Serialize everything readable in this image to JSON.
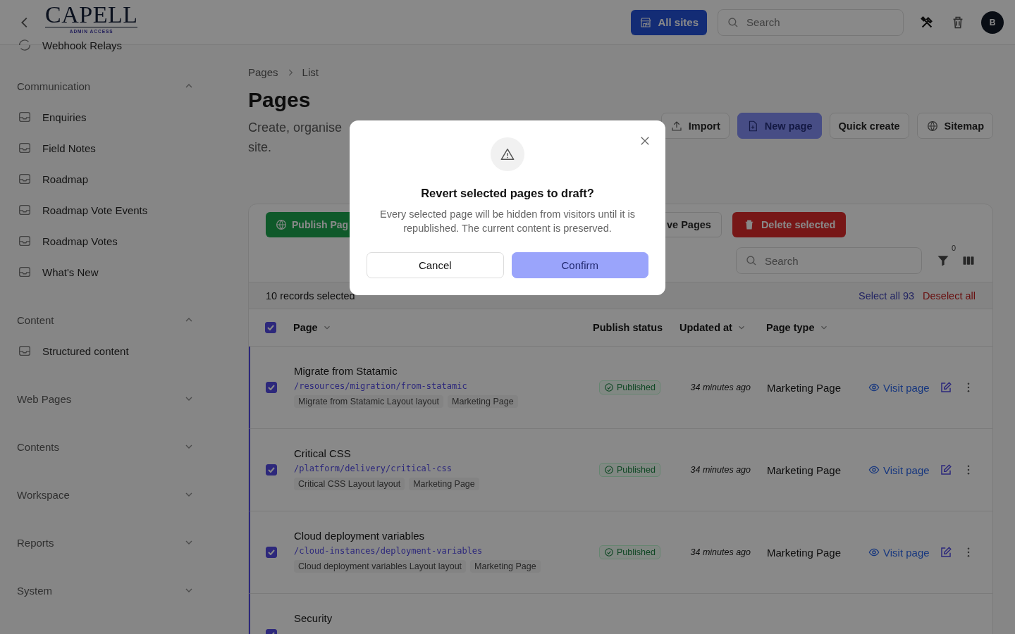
{
  "header": {
    "logo": {
      "name": "CAPELL",
      "tagline": "ADMIN ACCESS"
    },
    "sites_button": "All sites",
    "search": {
      "placeholder": "Search"
    },
    "avatar": "B"
  },
  "sidebar": {
    "partial_item": "Webhook Relays",
    "groups": [
      {
        "label": "Communication",
        "expanded": true,
        "items": [
          "Enquiries",
          "Field Notes",
          "Roadmap",
          "Roadmap Vote Events",
          "Roadmap Votes",
          "What's New"
        ]
      },
      {
        "label": "Content",
        "expanded": true,
        "items": [
          "Structured content"
        ]
      },
      {
        "label": "Web Pages",
        "expanded": false
      },
      {
        "label": "Contents",
        "expanded": false
      },
      {
        "label": "Workspace",
        "expanded": false
      },
      {
        "label": "Reports",
        "expanded": false
      },
      {
        "label": "System",
        "expanded": false
      }
    ]
  },
  "breadcrumb": [
    "Pages",
    "List"
  ],
  "title": "Pages",
  "subtitle_lines": [
    "Create, organise",
    "site."
  ],
  "page_actions": [
    {
      "label": "Import",
      "kind": "import"
    },
    {
      "label": "New page",
      "kind": "primary"
    },
    {
      "label": "Quick create",
      "kind": "plain"
    },
    {
      "label": "Sitemap",
      "kind": "sitemap"
    }
  ],
  "bulk_actions": [
    {
      "label": "Publish Pag",
      "kind": "publish"
    },
    {
      "label": "ve Pages",
      "kind": "plain"
    },
    {
      "label": "Delete selected",
      "kind": "danger"
    }
  ],
  "table_search": {
    "placeholder": "Search"
  },
  "filter_count": "0",
  "selection": {
    "text": "10 records selected",
    "select_all": "Select all 93",
    "deselect_all": "Deselect all"
  },
  "table": {
    "all_checked": true,
    "columns": [
      {
        "label": "Page",
        "sortable": true
      },
      {
        "label": "Publish status",
        "sortable": false
      },
      {
        "label": "Updated at",
        "sortable": true
      },
      {
        "label": "Page type",
        "sortable": true
      }
    ],
    "rows": [
      {
        "checked": true,
        "name": "Migrate from Statamic",
        "path": "/resources/migration/from-statamic",
        "tags": [
          "Migrate from Statamic Layout layout",
          "Marketing Page"
        ],
        "status": "Published",
        "updated": "34 minutes ago",
        "page_type": "Marketing Page",
        "visit": "Visit page"
      },
      {
        "checked": true,
        "name": "Critical CSS",
        "path": "/platform/delivery/critical-css",
        "tags": [
          "Critical CSS Layout layout",
          "Marketing Page"
        ],
        "status": "Published",
        "updated": "34 minutes ago",
        "page_type": "Marketing Page",
        "visit": "Visit page"
      },
      {
        "checked": true,
        "name": "Cloud deployment variables",
        "path": "/cloud-instances/deployment-variables",
        "tags": [
          "Cloud deployment variables Layout layout",
          "Marketing Page"
        ],
        "status": "Published",
        "updated": "34 minutes ago",
        "page_type": "Marketing Page",
        "visit": "Visit page"
      },
      {
        "checked": true,
        "name": "Security"
      }
    ]
  },
  "dialog": {
    "title": "Revert selected pages to draft?",
    "message": "Every selected page will be hidden from visitors until it is republished. The current content is preserved.",
    "cancel": "Cancel",
    "confirm": "Confirm"
  }
}
